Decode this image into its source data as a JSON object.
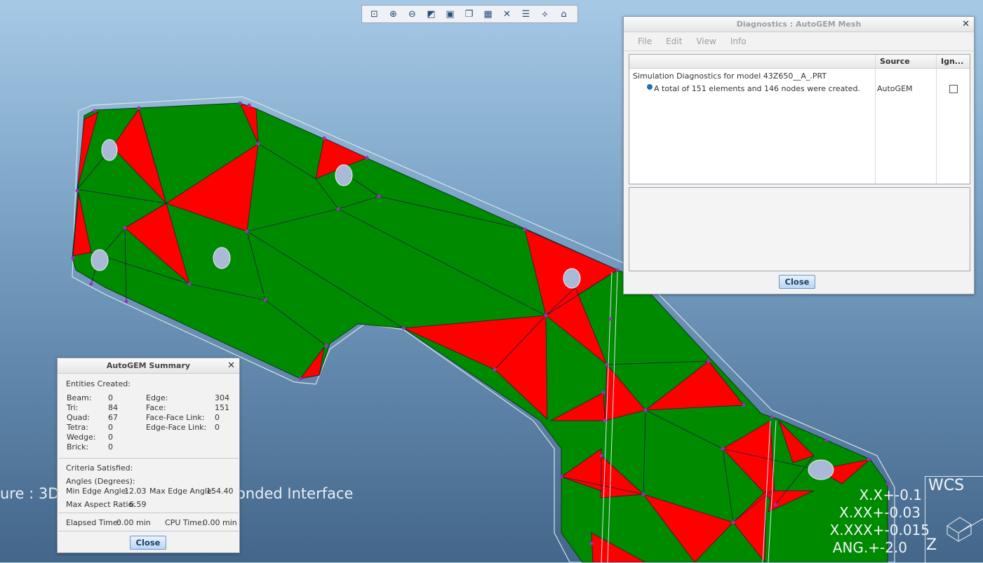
{
  "toolbar": {
    "icons": [
      "zoom-fit-icon",
      "zoom-in-icon",
      "zoom-out-icon",
      "shading-icon",
      "view-box-icon",
      "saved-views-icon",
      "camera-icon",
      "mesh-toggle-icon",
      "display-icon",
      "node-icon",
      "model-tree-icon"
    ]
  },
  "viewport": {
    "status_left": "ure : 3D",
    "status_right": "onded Interface",
    "tolerances": [
      "X.X+-0.1",
      "X.XX+-0.03",
      "X.XXX+-0.015",
      "ANG.+-2.0"
    ],
    "wcs_label": "WCS",
    "z_label": "Z"
  },
  "colors": {
    "mesh_green": "#008a00",
    "mesh_red": "#ff0000",
    "node": "#9b2fc0"
  },
  "diagnostics": {
    "title": "Diagnostics : AutoGEM Mesh",
    "menu": [
      "File",
      "Edit",
      "View",
      "Info"
    ],
    "columns": [
      "Source",
      "Ign..."
    ],
    "parent_row": "Simulation Diagnostics for model 43Z650__A_.PRT",
    "child_row": {
      "message": "A total of 151 elements and 146 nodes were created.",
      "source": "AutoGEM"
    },
    "close_label": "Close"
  },
  "summary": {
    "title": "AutoGEM Summary",
    "entities_header": "Entities Created:",
    "left_labels": [
      "Beam:",
      "Tri:",
      "Quad:",
      "Tetra:",
      "Wedge:",
      "Brick:"
    ],
    "left_values": [
      "0",
      "84",
      "67",
      "0",
      "0",
      "0"
    ],
    "right_labels": [
      "Edge:",
      "Face:",
      "Face-Face Link:",
      "Edge-Face Link:"
    ],
    "right_values": [
      "304",
      "151",
      "0",
      "0"
    ],
    "criteria_header": "Criteria Satisfied:",
    "angles_header": "Angles (Degrees):",
    "min_edge_label": "Min Edge Angle:",
    "min_edge_value": "12.03",
    "max_edge_label": "Max Edge Angle:",
    "max_edge_value": "154.40",
    "max_aspect_label": "Max Aspect Ratio:",
    "max_aspect_value": "6.59",
    "elapsed_label": "Elapsed Time:",
    "elapsed_value": "0.00 min",
    "cpu_label": "CPU Time:",
    "cpu_value": "0.00 min",
    "close_label": "Close"
  }
}
